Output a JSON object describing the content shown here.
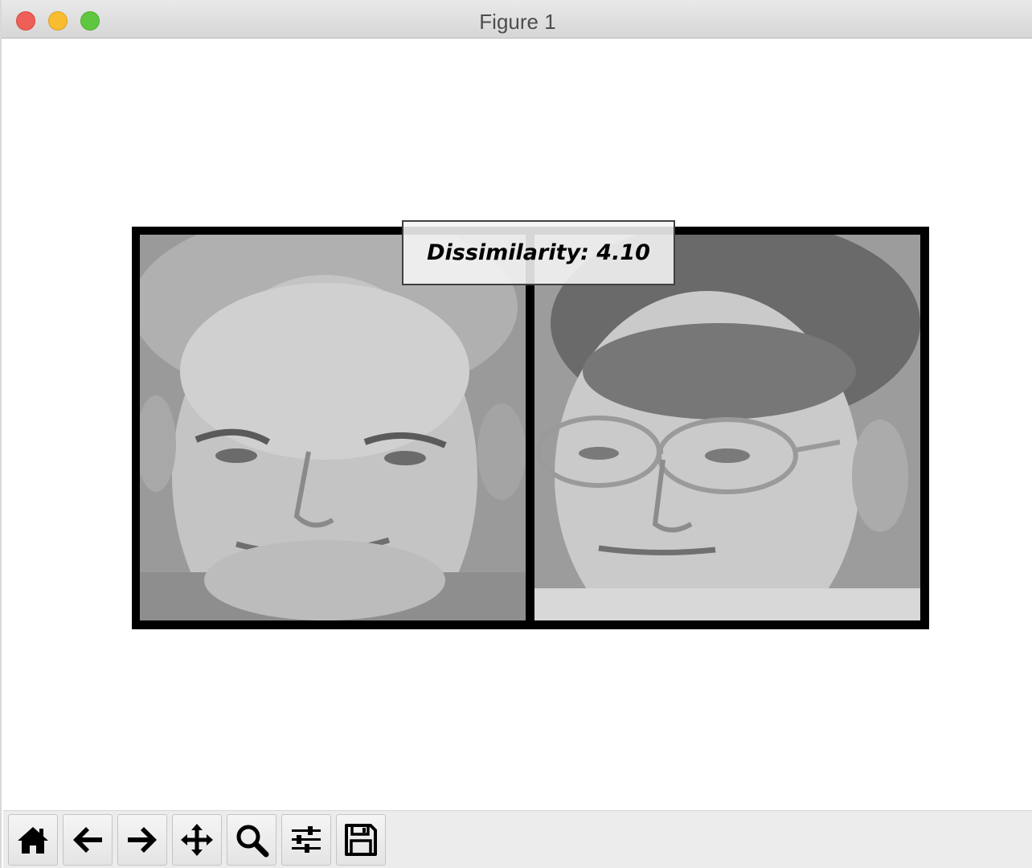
{
  "window": {
    "title": "Figure 1"
  },
  "figure": {
    "annotation": "Dissimilarity: 4.10"
  },
  "toolbar": {
    "buttons": [
      {
        "icon": "home-icon",
        "name": "home-button"
      },
      {
        "icon": "back-arrow-icon",
        "name": "back-button"
      },
      {
        "icon": "forward-arrow-icon",
        "name": "forward-button"
      },
      {
        "icon": "move-icon",
        "name": "pan-button"
      },
      {
        "icon": "magnifier-icon",
        "name": "zoom-button"
      },
      {
        "icon": "sliders-icon",
        "name": "configure-subplots-button"
      },
      {
        "icon": "floppy-disk-icon",
        "name": "save-button"
      }
    ]
  },
  "colors": {
    "frame": "#000000",
    "toolbar_bg": "#ececec",
    "titlebar_bg": "#dedede",
    "close": "#ee5f57",
    "minimize": "#f8bd2e",
    "maximize": "#5ec73f"
  }
}
